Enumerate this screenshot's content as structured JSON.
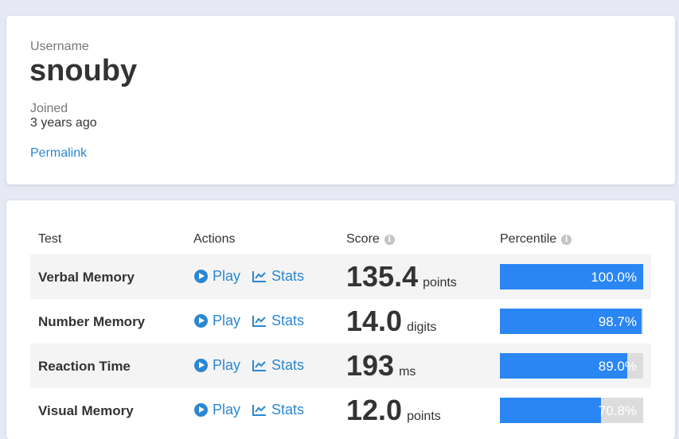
{
  "profile": {
    "username_label": "Username",
    "username": "snouby",
    "joined_label": "Joined",
    "joined": "3 years ago",
    "permalink": "Permalink"
  },
  "table": {
    "headers": {
      "test": "Test",
      "actions": "Actions",
      "score": "Score",
      "percentile": "Percentile"
    },
    "play_label": "Play",
    "stats_label": "Stats",
    "rows": [
      {
        "name": "Verbal Memory",
        "score": "135.4",
        "unit": "points",
        "percentile": "100.0%",
        "percentile_value": 100.0
      },
      {
        "name": "Number Memory",
        "score": "14.0",
        "unit": "digits",
        "percentile": "98.7%",
        "percentile_value": 98.7
      },
      {
        "name": "Reaction Time",
        "score": "193",
        "unit": "ms",
        "percentile": "89.0%",
        "percentile_value": 89.0
      },
      {
        "name": "Visual Memory",
        "score": "12.0",
        "unit": "points",
        "percentile": "70.8%",
        "percentile_value": 70.8
      }
    ]
  },
  "colors": {
    "accent": "#2b87d1",
    "bar": "#2a86f2",
    "background": "#e6e8f4"
  }
}
